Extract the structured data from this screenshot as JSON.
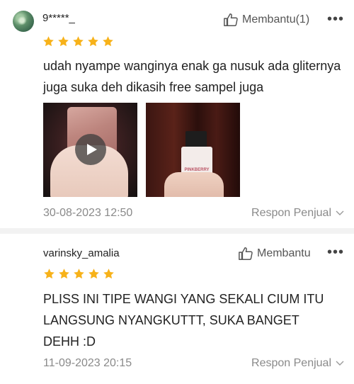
{
  "colors": {
    "star": "#f7b21a",
    "muted": "#8a8a8a",
    "text": "#222222"
  },
  "reviews": [
    {
      "username": "9*****_",
      "helpful_label": "Membantu(1)",
      "more": "•••",
      "rating": 5,
      "text": "udah nyampe wanginya enak ga nusuk ada gliternya juga suka deh dikasih free sampel juga",
      "photo2_label": "PINKBERRY SQUASH",
      "date": "30-08-2023 12:50",
      "respond_label": "Respon Penjual"
    },
    {
      "username": "varinsky_amalia",
      "helpful_label": "Membantu",
      "more": "•••",
      "rating": 5,
      "text": "PLISS INI TIPE WANGI YANG SEKALI CIUM ITU LANGSUNG NYANGKUTTT, SUKA BANGET DEHH :D",
      "date": "11-09-2023 20:15",
      "respond_label": "Respon Penjual"
    }
  ]
}
